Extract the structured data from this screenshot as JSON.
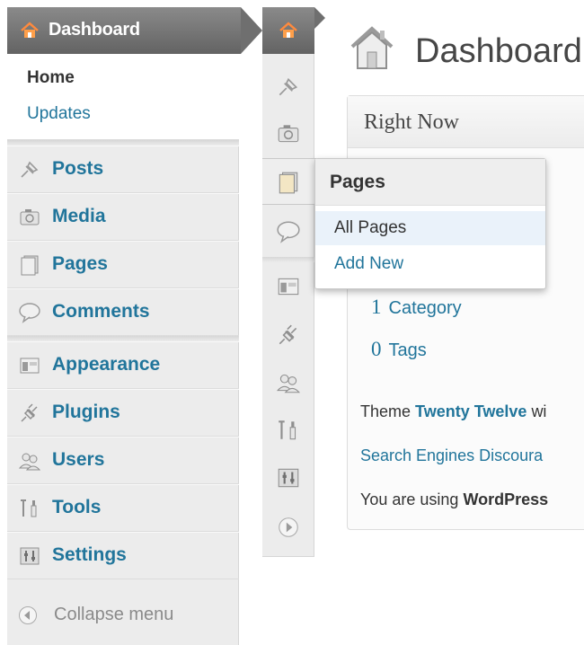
{
  "sidebar": {
    "header": {
      "label": "Dashboard",
      "icon": "home-icon"
    },
    "submenu": {
      "home": "Home",
      "updates": "Updates"
    },
    "items": [
      {
        "label": "Posts",
        "icon": "pushpin-icon"
      },
      {
        "label": "Media",
        "icon": "media-camera-icon"
      },
      {
        "label": "Pages",
        "icon": "pages-icon"
      },
      {
        "label": "Comments",
        "icon": "speech-bubble-icon"
      },
      {
        "label": "Appearance",
        "icon": "appearance-icon"
      },
      {
        "label": "Plugins",
        "icon": "plug-icon"
      },
      {
        "label": "Users",
        "icon": "users-icon"
      },
      {
        "label": "Tools",
        "icon": "tools-icon"
      },
      {
        "label": "Settings",
        "icon": "settings-icon"
      }
    ],
    "collapse": {
      "label": "Collapse menu",
      "icon": "collapse-arrow-icon"
    }
  },
  "main": {
    "title": "Dashboard",
    "right_now": {
      "title": "Right Now",
      "categories": {
        "count": "1",
        "label": "Category"
      },
      "tags": {
        "count": "0",
        "label": "Tags"
      },
      "theme_prefix": "Theme",
      "theme_name": "Twenty Twelve",
      "theme_suffix": "wi",
      "search_engines": "Search Engines Discoura",
      "using_prefix": "You are using",
      "using_name": "WordPress"
    }
  },
  "flyout": {
    "title": "Pages",
    "items": [
      "All Pages",
      "Add New"
    ]
  },
  "colors": {
    "link": "#21759b",
    "menu_bg": "#ececec",
    "header_bg": "#707070",
    "hover_bg": "#eaf2fa"
  }
}
